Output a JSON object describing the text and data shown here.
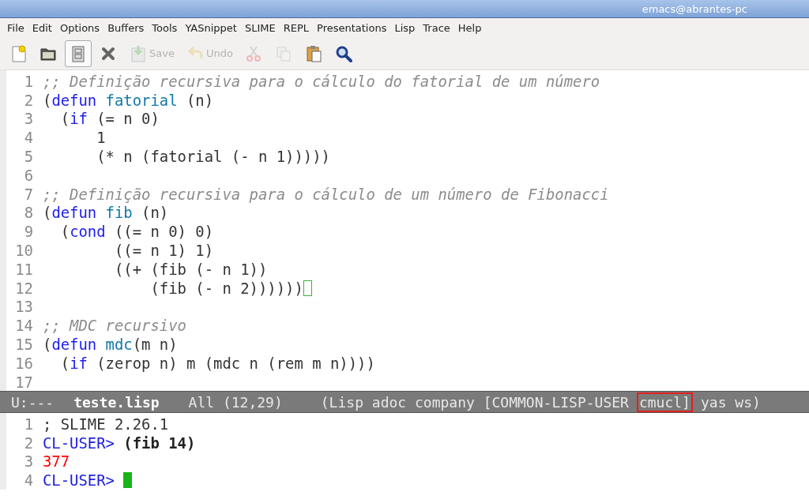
{
  "window": {
    "title": "emacs@abrantes-pc"
  },
  "menu": [
    "File",
    "Edit",
    "Options",
    "Buffers",
    "Tools",
    "YASnippet",
    "SLIME",
    "REPL",
    "Presentations",
    "Lisp",
    "Trace",
    "Help"
  ],
  "toolbar": [
    {
      "kind": "new",
      "disabled": false,
      "pressed": false
    },
    {
      "kind": "open",
      "disabled": false,
      "pressed": false
    },
    {
      "kind": "cabinet",
      "disabled": false,
      "pressed": true
    },
    {
      "kind": "close",
      "disabled": false,
      "pressed": false
    },
    {
      "kind": "save",
      "label": "Save",
      "disabled": true,
      "pressed": false
    },
    {
      "kind": "undo",
      "label": "Undo",
      "disabled": true,
      "pressed": false
    },
    {
      "kind": "cut",
      "disabled": true,
      "pressed": false
    },
    {
      "kind": "copy",
      "disabled": true,
      "pressed": false
    },
    {
      "kind": "paste",
      "disabled": false,
      "pressed": false
    },
    {
      "kind": "search",
      "disabled": false,
      "pressed": false
    }
  ],
  "editor": {
    "focused": false,
    "lines": [
      {
        "number": "1",
        "cursor": false,
        "tokens": [
          {
            "kind": "comment",
            "text": ";; Definição recursiva para o cálculo do fatorial de um número"
          }
        ]
      },
      {
        "number": "2",
        "cursor": false,
        "tokens": [
          {
            "kind": "plain",
            "text": "("
          },
          {
            "kind": "keyword",
            "text": "defun"
          },
          {
            "kind": "function",
            "text": " fatorial"
          },
          {
            "kind": "plain",
            "text": " (n)"
          }
        ]
      },
      {
        "number": "3",
        "cursor": false,
        "tokens": [
          {
            "kind": "plain",
            "text": "  ("
          },
          {
            "kind": "keyword",
            "text": "if"
          },
          {
            "kind": "plain",
            "text": " (= n 0)"
          }
        ]
      },
      {
        "number": "4",
        "cursor": false,
        "tokens": [
          {
            "kind": "plain",
            "text": "      1"
          }
        ]
      },
      {
        "number": "5",
        "cursor": false,
        "tokens": [
          {
            "kind": "plain",
            "text": "      (* n (fatorial (- n 1)))))"
          }
        ]
      },
      {
        "number": "6",
        "cursor": false
      },
      {
        "number": "7",
        "cursor": false,
        "tokens": [
          {
            "kind": "comment",
            "text": ";; Definição recursiva para o cálculo de um número de Fibonacci"
          }
        ]
      },
      {
        "number": "8",
        "cursor": false,
        "tokens": [
          {
            "kind": "plain",
            "text": "("
          },
          {
            "kind": "keyword",
            "text": "defun"
          },
          {
            "kind": "function",
            "text": " fib"
          },
          {
            "kind": "plain",
            "text": " (n)"
          }
        ]
      },
      {
        "number": "9",
        "cursor": false,
        "tokens": [
          {
            "kind": "plain",
            "text": "  ("
          },
          {
            "kind": "keyword",
            "text": "cond"
          },
          {
            "kind": "plain",
            "text": " ((= n 0) 0)"
          }
        ]
      },
      {
        "number": "10",
        "cursor": false,
        "tokens": [
          {
            "kind": "plain",
            "text": "        ((= n 1) 1)"
          }
        ]
      },
      {
        "number": "11",
        "cursor": false,
        "tokens": [
          {
            "kind": "plain",
            "text": "        ((+ (fib (- n 1))"
          }
        ]
      },
      {
        "number": "12",
        "cursor": true,
        "tokens": [
          {
            "kind": "plain",
            "text": "            (fib (- n 2))))))"
          }
        ]
      },
      {
        "number": "13",
        "cursor": false
      },
      {
        "number": "14",
        "cursor": false,
        "tokens": [
          {
            "kind": "comment",
            "text": ";; MDC recursivo"
          }
        ]
      },
      {
        "number": "15",
        "cursor": false,
        "tokens": [
          {
            "kind": "plain",
            "text": "("
          },
          {
            "kind": "keyword",
            "text": "defun"
          },
          {
            "kind": "function",
            "text": " mdc"
          },
          {
            "kind": "plain",
            "text": "(m n)"
          }
        ]
      },
      {
        "number": "16",
        "cursor": false,
        "tokens": [
          {
            "kind": "plain",
            "text": "  ("
          },
          {
            "kind": "keyword",
            "text": "if"
          },
          {
            "kind": "plain",
            "text": " (zerop n) m (mdc n (rem m n))))"
          }
        ]
      },
      {
        "number": "17",
        "cursor": false
      }
    ]
  },
  "mode_line": {
    "status": "U:---",
    "buffer": "teste.lisp",
    "position": "All (12,29)",
    "modes": [
      {
        "text": "(Lisp adoc company [COMMON-LISP-USER",
        "highlighted": false
      },
      {
        "text": "cmucl]",
        "highlighted": true
      },
      {
        "text": "yas ws)",
        "highlighted": false
      }
    ]
  },
  "repl": {
    "focused": true,
    "lines": [
      {
        "number": "1",
        "cursor": false,
        "tokens": [
          {
            "kind": "plain",
            "text": "; SLIME 2.26.1"
          }
        ]
      },
      {
        "number": "2",
        "cursor": false,
        "tokens": [
          {
            "kind": "prompt",
            "text": "CL-USER> "
          },
          {
            "kind": "input",
            "text": "(fib 14)"
          }
        ]
      },
      {
        "number": "3",
        "cursor": false,
        "tokens": [
          {
            "kind": "result",
            "text": "377"
          }
        ]
      },
      {
        "number": "4",
        "cursor": true,
        "tokens": [
          {
            "kind": "prompt",
            "text": "CL-USER> "
          }
        ]
      }
    ]
  }
}
